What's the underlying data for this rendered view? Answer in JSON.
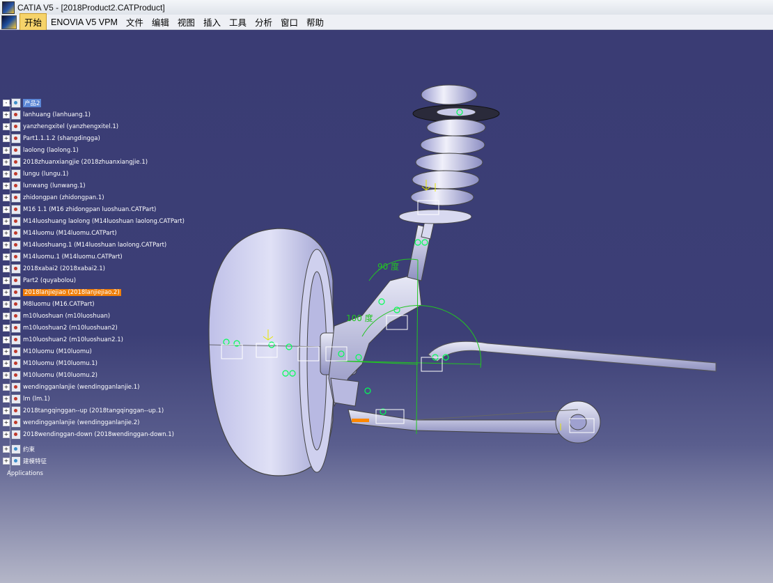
{
  "window": {
    "title": "CATIA V5 - [2018Product2.CATProduct]"
  },
  "menu": {
    "items": [
      "开始",
      "ENOVIA V5 VPM",
      "文件",
      "编辑",
      "视图",
      "插入",
      "工具",
      "分析",
      "窗口",
      "帮助"
    ]
  },
  "tree": {
    "root": "产品2",
    "items": [
      "lanhuang (lanhuang.1)",
      "yanzhengxitel (yanzhengxitel.1)",
      "Part1.1.1.2 (shangdingga)",
      "laolong (laolong.1)",
      "2018zhuanxiangjie (2018zhuanxiangjie.1)",
      "lungu (lungu.1)",
      "lunwang (lunwang.1)",
      "zhidongpan (zhidongpan.1)",
      "M16 1.1 (M16 zhidongpan luoshuan.CATPart)",
      "M14luoshuang laolong (M14luoshuan laolong.CATPart)",
      "M14luomu (M14luomu.CATPart)",
      "M14luoshuang.1 (M14luoshuan laolong.CATPart)",
      "M14luomu.1 (M14luomu.CATPart)",
      "2018xabai2 (2018xabai2.1)",
      "Part2 (quyabolou)",
      "2018lanjiejiao (2018lanjiejiao.2)",
      "M8luomu (M16.CATPart)",
      "m10luoshuan (m10luoshuan)",
      "m10luoshuan2 (m10luoshuan2)",
      "m10luoshuan2 (m10luoshuan2.1)",
      "M10luomu (M10luomu)",
      "M10luomu (M10luomu.1)",
      "M10luomu (M10luomu.2)",
      "wendingganlanjie (wendingganlanjie.1)",
      "lm (lm.1)",
      "2018tangqinggan--up (2018tangqinggan--up.1)",
      "wendingganlanjie (wendingganlanjie.2)",
      "2018wendinggan-down (2018wendinggan-down.1)"
    ],
    "selected_index": 15,
    "constraints": "约束",
    "features": "建模特征",
    "applications": "Applications"
  },
  "annotations": {
    "angle1": "90 度",
    "angle2": "100 度"
  },
  "colors": {
    "background_top": "#3a3c74",
    "background_bottom": "#b4b6c8",
    "selection": "#f07f0a",
    "constraint": "#22c522",
    "dimension": "#e6e600"
  }
}
